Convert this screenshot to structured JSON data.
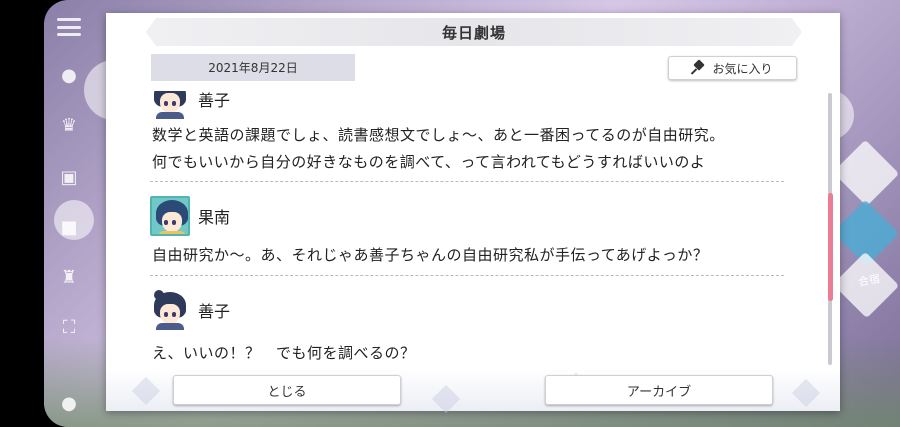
{
  "dialog": {
    "title": "毎日劇場",
    "date": "2021年8月22日",
    "favorite_label": "お気に入り",
    "close_label": "とじる",
    "archive_label": "アーカイブ"
  },
  "messages": [
    {
      "speaker": "善子",
      "lines": [
        "数学と英語の課題でしょ、読書感想文でしょ〜、あと一番困ってるのが自由研究。",
        "何でもいいから自分の好きなものを調べて、って言われてもどうすればいいのよ"
      ]
    },
    {
      "speaker": "果南",
      "lines": [
        "自由研究か〜。あ、それじゃあ善子ちゃんの自由研究私が手伝ってあげよっか？"
      ]
    },
    {
      "speaker": "善子",
      "lines": [
        "え、いいの！？　でも何を調べるの？"
      ]
    }
  ],
  "background": {
    "tile_label": "合宿"
  },
  "colors": {
    "scroll_thumb": "#ec7b94",
    "kanan_avatar_bg": "#70c9c6"
  }
}
